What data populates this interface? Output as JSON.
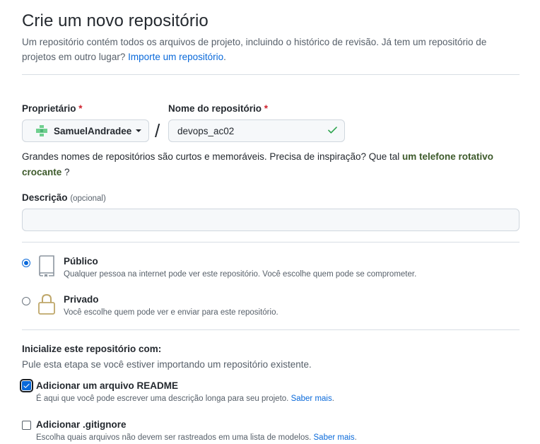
{
  "header": {
    "title": "Crie um novo repositório",
    "subtitle": "Um repositório contém todos os arquivos de projeto, incluindo o histórico de revisão. Já tem um repositório de projetos em outro lugar?",
    "import_link": "Importe um repositório",
    "import_suffix": "."
  },
  "owner": {
    "label": "Proprietário",
    "required_mark": "*",
    "value": "SamuelAndradee"
  },
  "repo_name": {
    "label": "Nome do repositório",
    "required_mark": "*",
    "value": "devops_ac02",
    "separator": "/"
  },
  "hint": {
    "text": "Grandes nomes de repositórios são curtos e memoráveis. Precisa de inspiração? Que tal",
    "suggestion": "um telefone rotativo crocante",
    "suffix": " ?"
  },
  "description": {
    "label": "Descrição",
    "optional": "(opcional)",
    "value": ""
  },
  "visibility": {
    "public": {
      "title": "Público",
      "subtitle": "Qualquer pessoa na internet pode ver este repositório. Você escolhe quem pode se comprometer.",
      "selected": true
    },
    "private": {
      "title": "Privado",
      "subtitle": "Você escolhe quem pode ver e enviar para este repositório.",
      "selected": false
    }
  },
  "initialize": {
    "title": "Inicialize este repositório com:",
    "subtitle": "Pule esta etapa se você estiver importando um repositório existente.",
    "readme": {
      "label": "Adicionar um arquivo README",
      "help": "É aqui que você pode escrever uma descrição longa para seu projeto.",
      "link": "Saber mais",
      "checked": true
    },
    "gitignore": {
      "label": "Adicionar .gitignore",
      "help": "Escolha quais arquivos não devem ser rastreados em uma lista de modelos.",
      "link": "Saber mais",
      "checked": false
    }
  },
  "colors": {
    "accent": "#0969da",
    "success": "#2da44e",
    "danger": "#cf222e",
    "suggestion": "#3d5a2b"
  }
}
